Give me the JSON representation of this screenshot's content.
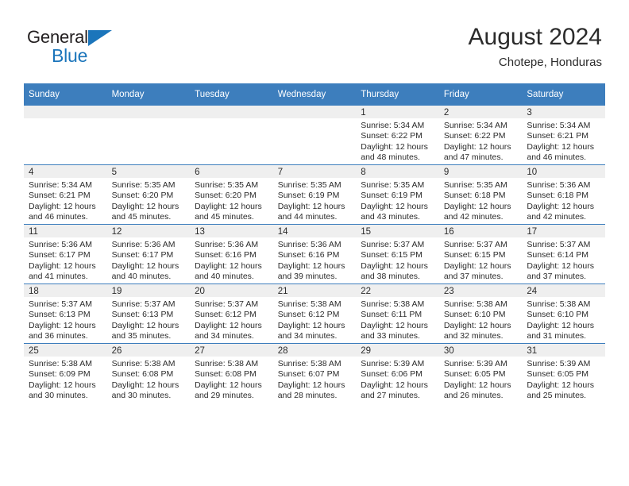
{
  "logo": {
    "word_top": "General",
    "word_bottom": "Blue",
    "accent_color": "#1b75bb",
    "triangle_icon": "triangle-icon"
  },
  "header": {
    "title": "August 2024",
    "location": "Chotepe, Honduras"
  },
  "theme": {
    "header_blue": "#3d7ebd",
    "daynum_band": "#efefef",
    "text": "#2b2b2b"
  },
  "calendar": {
    "weekday_headers": [
      "Sunday",
      "Monday",
      "Tuesday",
      "Wednesday",
      "Thursday",
      "Friday",
      "Saturday"
    ],
    "weeks": [
      [
        {
          "day": "",
          "sunrise": "",
          "sunset": "",
          "daylight1": "",
          "daylight2": "",
          "empty": true
        },
        {
          "day": "",
          "sunrise": "",
          "sunset": "",
          "daylight1": "",
          "daylight2": "",
          "empty": true
        },
        {
          "day": "",
          "sunrise": "",
          "sunset": "",
          "daylight1": "",
          "daylight2": "",
          "empty": true
        },
        {
          "day": "",
          "sunrise": "",
          "sunset": "",
          "daylight1": "",
          "daylight2": "",
          "empty": true
        },
        {
          "day": "1",
          "sunrise": "Sunrise: 5:34 AM",
          "sunset": "Sunset: 6:22 PM",
          "daylight1": "Daylight: 12 hours",
          "daylight2": "and 48 minutes.",
          "empty": false
        },
        {
          "day": "2",
          "sunrise": "Sunrise: 5:34 AM",
          "sunset": "Sunset: 6:22 PM",
          "daylight1": "Daylight: 12 hours",
          "daylight2": "and 47 minutes.",
          "empty": false
        },
        {
          "day": "3",
          "sunrise": "Sunrise: 5:34 AM",
          "sunset": "Sunset: 6:21 PM",
          "daylight1": "Daylight: 12 hours",
          "daylight2": "and 46 minutes.",
          "empty": false
        }
      ],
      [
        {
          "day": "4",
          "sunrise": "Sunrise: 5:34 AM",
          "sunset": "Sunset: 6:21 PM",
          "daylight1": "Daylight: 12 hours",
          "daylight2": "and 46 minutes.",
          "empty": false
        },
        {
          "day": "5",
          "sunrise": "Sunrise: 5:35 AM",
          "sunset": "Sunset: 6:20 PM",
          "daylight1": "Daylight: 12 hours",
          "daylight2": "and 45 minutes.",
          "empty": false
        },
        {
          "day": "6",
          "sunrise": "Sunrise: 5:35 AM",
          "sunset": "Sunset: 6:20 PM",
          "daylight1": "Daylight: 12 hours",
          "daylight2": "and 45 minutes.",
          "empty": false
        },
        {
          "day": "7",
          "sunrise": "Sunrise: 5:35 AM",
          "sunset": "Sunset: 6:19 PM",
          "daylight1": "Daylight: 12 hours",
          "daylight2": "and 44 minutes.",
          "empty": false
        },
        {
          "day": "8",
          "sunrise": "Sunrise: 5:35 AM",
          "sunset": "Sunset: 6:19 PM",
          "daylight1": "Daylight: 12 hours",
          "daylight2": "and 43 minutes.",
          "empty": false
        },
        {
          "day": "9",
          "sunrise": "Sunrise: 5:35 AM",
          "sunset": "Sunset: 6:18 PM",
          "daylight1": "Daylight: 12 hours",
          "daylight2": "and 42 minutes.",
          "empty": false
        },
        {
          "day": "10",
          "sunrise": "Sunrise: 5:36 AM",
          "sunset": "Sunset: 6:18 PM",
          "daylight1": "Daylight: 12 hours",
          "daylight2": "and 42 minutes.",
          "empty": false
        }
      ],
      [
        {
          "day": "11",
          "sunrise": "Sunrise: 5:36 AM",
          "sunset": "Sunset: 6:17 PM",
          "daylight1": "Daylight: 12 hours",
          "daylight2": "and 41 minutes.",
          "empty": false
        },
        {
          "day": "12",
          "sunrise": "Sunrise: 5:36 AM",
          "sunset": "Sunset: 6:17 PM",
          "daylight1": "Daylight: 12 hours",
          "daylight2": "and 40 minutes.",
          "empty": false
        },
        {
          "day": "13",
          "sunrise": "Sunrise: 5:36 AM",
          "sunset": "Sunset: 6:16 PM",
          "daylight1": "Daylight: 12 hours",
          "daylight2": "and 40 minutes.",
          "empty": false
        },
        {
          "day": "14",
          "sunrise": "Sunrise: 5:36 AM",
          "sunset": "Sunset: 6:16 PM",
          "daylight1": "Daylight: 12 hours",
          "daylight2": "and 39 minutes.",
          "empty": false
        },
        {
          "day": "15",
          "sunrise": "Sunrise: 5:37 AM",
          "sunset": "Sunset: 6:15 PM",
          "daylight1": "Daylight: 12 hours",
          "daylight2": "and 38 minutes.",
          "empty": false
        },
        {
          "day": "16",
          "sunrise": "Sunrise: 5:37 AM",
          "sunset": "Sunset: 6:15 PM",
          "daylight1": "Daylight: 12 hours",
          "daylight2": "and 37 minutes.",
          "empty": false
        },
        {
          "day": "17",
          "sunrise": "Sunrise: 5:37 AM",
          "sunset": "Sunset: 6:14 PM",
          "daylight1": "Daylight: 12 hours",
          "daylight2": "and 37 minutes.",
          "empty": false
        }
      ],
      [
        {
          "day": "18",
          "sunrise": "Sunrise: 5:37 AM",
          "sunset": "Sunset: 6:13 PM",
          "daylight1": "Daylight: 12 hours",
          "daylight2": "and 36 minutes.",
          "empty": false
        },
        {
          "day": "19",
          "sunrise": "Sunrise: 5:37 AM",
          "sunset": "Sunset: 6:13 PM",
          "daylight1": "Daylight: 12 hours",
          "daylight2": "and 35 minutes.",
          "empty": false
        },
        {
          "day": "20",
          "sunrise": "Sunrise: 5:37 AM",
          "sunset": "Sunset: 6:12 PM",
          "daylight1": "Daylight: 12 hours",
          "daylight2": "and 34 minutes.",
          "empty": false
        },
        {
          "day": "21",
          "sunrise": "Sunrise: 5:38 AM",
          "sunset": "Sunset: 6:12 PM",
          "daylight1": "Daylight: 12 hours",
          "daylight2": "and 34 minutes.",
          "empty": false
        },
        {
          "day": "22",
          "sunrise": "Sunrise: 5:38 AM",
          "sunset": "Sunset: 6:11 PM",
          "daylight1": "Daylight: 12 hours",
          "daylight2": "and 33 minutes.",
          "empty": false
        },
        {
          "day": "23",
          "sunrise": "Sunrise: 5:38 AM",
          "sunset": "Sunset: 6:10 PM",
          "daylight1": "Daylight: 12 hours",
          "daylight2": "and 32 minutes.",
          "empty": false
        },
        {
          "day": "24",
          "sunrise": "Sunrise: 5:38 AM",
          "sunset": "Sunset: 6:10 PM",
          "daylight1": "Daylight: 12 hours",
          "daylight2": "and 31 minutes.",
          "empty": false
        }
      ],
      [
        {
          "day": "25",
          "sunrise": "Sunrise: 5:38 AM",
          "sunset": "Sunset: 6:09 PM",
          "daylight1": "Daylight: 12 hours",
          "daylight2": "and 30 minutes.",
          "empty": false
        },
        {
          "day": "26",
          "sunrise": "Sunrise: 5:38 AM",
          "sunset": "Sunset: 6:08 PM",
          "daylight1": "Daylight: 12 hours",
          "daylight2": "and 30 minutes.",
          "empty": false
        },
        {
          "day": "27",
          "sunrise": "Sunrise: 5:38 AM",
          "sunset": "Sunset: 6:08 PM",
          "daylight1": "Daylight: 12 hours",
          "daylight2": "and 29 minutes.",
          "empty": false
        },
        {
          "day": "28",
          "sunrise": "Sunrise: 5:38 AM",
          "sunset": "Sunset: 6:07 PM",
          "daylight1": "Daylight: 12 hours",
          "daylight2": "and 28 minutes.",
          "empty": false
        },
        {
          "day": "29",
          "sunrise": "Sunrise: 5:39 AM",
          "sunset": "Sunset: 6:06 PM",
          "daylight1": "Daylight: 12 hours",
          "daylight2": "and 27 minutes.",
          "empty": false
        },
        {
          "day": "30",
          "sunrise": "Sunrise: 5:39 AM",
          "sunset": "Sunset: 6:05 PM",
          "daylight1": "Daylight: 12 hours",
          "daylight2": "and 26 minutes.",
          "empty": false
        },
        {
          "day": "31",
          "sunrise": "Sunrise: 5:39 AM",
          "sunset": "Sunset: 6:05 PM",
          "daylight1": "Daylight: 12 hours",
          "daylight2": "and 25 minutes.",
          "empty": false
        }
      ]
    ]
  }
}
